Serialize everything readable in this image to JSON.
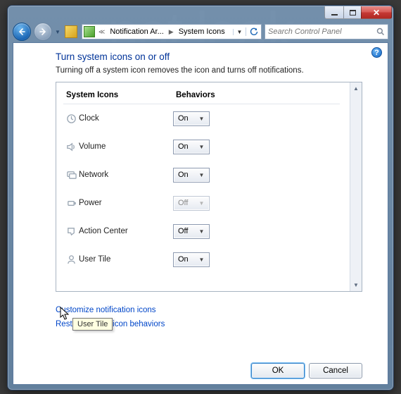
{
  "breadcrumb": {
    "seg1": "Notification Ar...",
    "seg2": "System Icons"
  },
  "search": {
    "placeholder": "Search Control Panel"
  },
  "heading": "Turn system icons on or off",
  "subtext": "Turning off a system icon removes the icon and turns off notifications.",
  "columns": {
    "icons": "System Icons",
    "behaviors": "Behaviors"
  },
  "rows": [
    {
      "name": "Clock",
      "value": "On",
      "disabled": false
    },
    {
      "name": "Volume",
      "value": "On",
      "disabled": false
    },
    {
      "name": "Network",
      "value": "On",
      "disabled": false
    },
    {
      "name": "Power",
      "value": "Off",
      "disabled": true
    },
    {
      "name": "Action Center",
      "value": "Off",
      "disabled": false
    },
    {
      "name": "User Tile",
      "value": "On",
      "disabled": false
    }
  ],
  "links": {
    "customize": "Customize notification icons",
    "restore": "Restore default icon behaviors"
  },
  "buttons": {
    "ok": "OK",
    "cancel": "Cancel"
  },
  "tooltip": "User Tile",
  "help_glyph": "?"
}
